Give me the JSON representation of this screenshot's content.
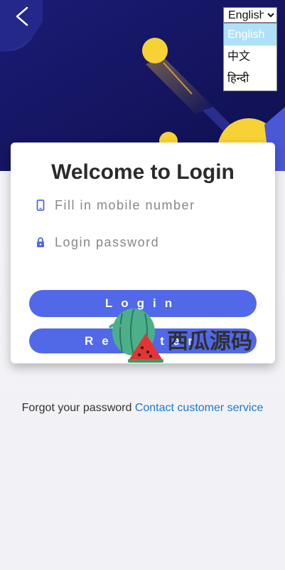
{
  "header": {
    "back_icon": "chevron-left-icon"
  },
  "language": {
    "selected": "English",
    "options": [
      "English",
      "中文",
      "हिन्दी"
    ]
  },
  "login_card": {
    "title": "Welcome to Login",
    "mobile": {
      "icon": "phone-icon",
      "placeholder": "Fill in mobile number",
      "value": ""
    },
    "password": {
      "icon": "lock-icon",
      "placeholder": "Login password",
      "value": ""
    },
    "login_button": "Login",
    "register_button": "Register"
  },
  "watermark": {
    "text": "西瓜源码"
  },
  "footer": {
    "forgot_text": "Forgot your password",
    "contact_link": "Contact customer service"
  },
  "colors": {
    "primary": "#5168e9",
    "hero_bg": "#151563",
    "accent_yellow": "#f7d234",
    "link": "#1e78c8"
  }
}
